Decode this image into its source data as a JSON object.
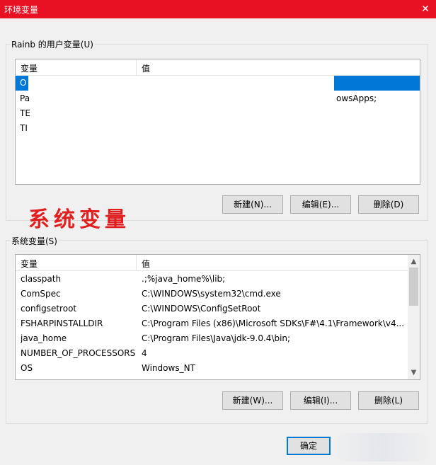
{
  "window": {
    "title": "环境变量",
    "close_glyph": "✕"
  },
  "user_vars": {
    "label": "Rainb 的用户变量(U)",
    "col_var": "变量",
    "col_val": "值",
    "rows": [
      {
        "name": "O",
        "value": ""
      },
      {
        "name": "Pa",
        "value": "owsApps;"
      },
      {
        "name": "TE",
        "value": ""
      },
      {
        "name": "TI",
        "value": ""
      }
    ],
    "buttons": {
      "new": "新建(N)...",
      "edit": "编辑(E)...",
      "delete": "删除(D)"
    }
  },
  "annotation": "系统变量",
  "system_vars": {
    "label": "系统变量(S)",
    "col_var": "变量",
    "col_val": "值",
    "rows": [
      {
        "name": "classpath",
        "value": ".;%java_home%\\lib;"
      },
      {
        "name": "ComSpec",
        "value": "C:\\WINDOWS\\system32\\cmd.exe"
      },
      {
        "name": "configsetroot",
        "value": "C:\\WINDOWS\\ConfigSetRoot"
      },
      {
        "name": "FSHARPINSTALLDIR",
        "value": "C:\\Program Files (x86)\\Microsoft SDKs\\F#\\4.1\\Framework\\v4...."
      },
      {
        "name": "java_home",
        "value": "C:\\Program Files\\Java\\jdk-9.0.4\\bin;"
      },
      {
        "name": "NUMBER_OF_PROCESSORS",
        "value": "4"
      },
      {
        "name": "OS",
        "value": "Windows_NT"
      }
    ],
    "buttons": {
      "new": "新建(W)...",
      "edit": "编辑(I)...",
      "delete": "删除(L)"
    }
  },
  "footer": {
    "ok": "确定"
  },
  "colors": {
    "titlebar": "#e81123",
    "selection": "#0078d7",
    "annotation": "#e02020"
  }
}
